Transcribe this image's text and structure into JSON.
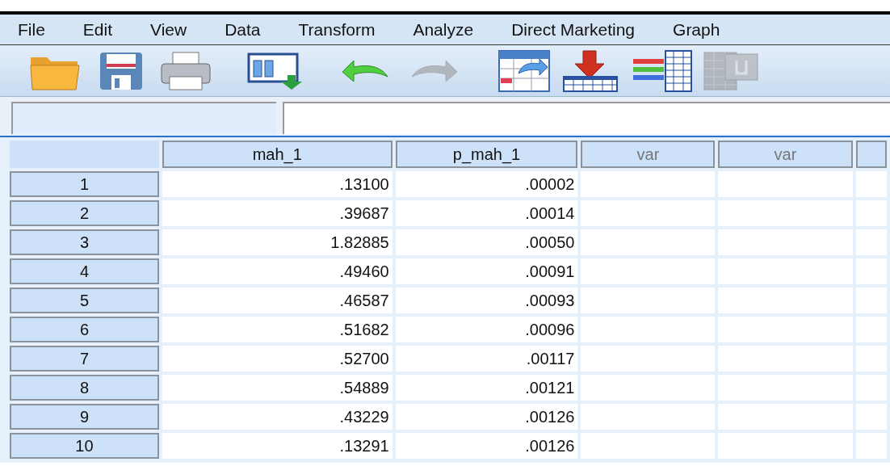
{
  "menu": [
    {
      "label": "File"
    },
    {
      "label": "Edit"
    },
    {
      "label": "View"
    },
    {
      "label": "Data"
    },
    {
      "label": "Transform"
    },
    {
      "label": "Analyze"
    },
    {
      "label": "Direct Marketing"
    },
    {
      "label": "Graph"
    }
  ],
  "toolbar": [
    {
      "disabled": false
    },
    {
      "disabled": false
    },
    {
      "disabled": false
    },
    {
      "disabled": false
    },
    {
      "disabled": false
    },
    {
      "disabled": true
    },
    {
      "disabled": false
    },
    {
      "disabled": false
    },
    {
      "disabled": false
    },
    {
      "disabled": true
    }
  ],
  "grid": {
    "columns": [
      {
        "label": "mah_1",
        "kind": "variable"
      },
      {
        "label": "p_mah_1",
        "kind": "variable"
      },
      {
        "label": "var",
        "kind": "empty"
      },
      {
        "label": "var",
        "kind": "empty"
      }
    ],
    "rows": [
      {
        "case": "1",
        "cells": [
          ".13100",
          ".00002"
        ]
      },
      {
        "case": "2",
        "cells": [
          ".39687",
          ".00014"
        ]
      },
      {
        "case": "3",
        "cells": [
          "1.82885",
          ".00050"
        ]
      },
      {
        "case": "4",
        "cells": [
          ".49460",
          ".00091"
        ]
      },
      {
        "case": "5",
        "cells": [
          ".46587",
          ".00093"
        ]
      },
      {
        "case": "6",
        "cells": [
          ".51682",
          ".00096"
        ]
      },
      {
        "case": "7",
        "cells": [
          ".52700",
          ".00117"
        ]
      },
      {
        "case": "8",
        "cells": [
          ".54889",
          ".00121"
        ]
      },
      {
        "case": "9",
        "cells": [
          ".43229",
          ".00126"
        ]
      },
      {
        "case": "10",
        "cells": [
          ".13291",
          ".00126"
        ]
      }
    ]
  }
}
